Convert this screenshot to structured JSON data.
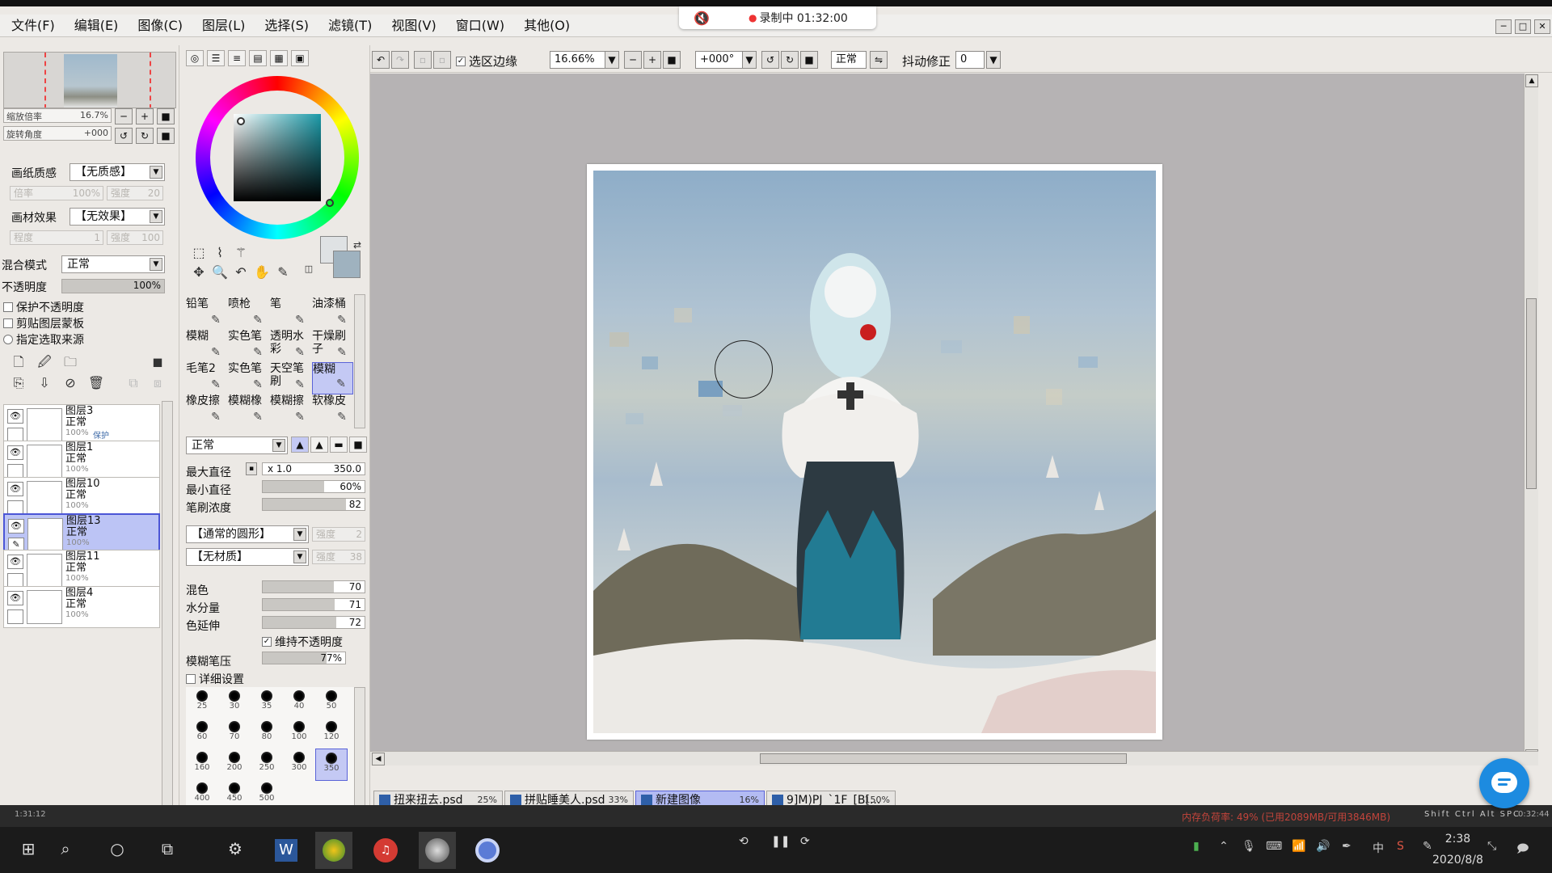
{
  "menu": [
    "文件(F)",
    "编辑(E)",
    "图像(C)",
    "图层(L)",
    "选择(S)",
    "滤镜(T)",
    "视图(V)",
    "窗口(W)",
    "其他(O)"
  ],
  "recording": {
    "label": "录制中 01:32:00",
    "mute_icon": "speaker-muted-icon"
  },
  "navigator": {
    "zoom_label": "缩放倍率",
    "zoom_value": "16.7%",
    "rotate_label": "旋转角度",
    "rotate_value": "+000"
  },
  "paper": {
    "texture_label": "画纸质感",
    "texture_value": "【无质感】",
    "strength_label": "倍率",
    "strength_value": "100%",
    "strength2_label": "强度",
    "strength2_value": "20",
    "effect_label": "画材效果",
    "effect_value": "【无效果】",
    "degree_label": "程度",
    "degree_value": "1",
    "degree2_label": "强度",
    "degree2_value": "100"
  },
  "blend": {
    "label": "混合模式",
    "value": "正常"
  },
  "opacity": {
    "label": "不透明度",
    "value": "100%",
    "fraction": 1.0
  },
  "checks": [
    "保护不透明度",
    "剪贴图层蒙板",
    "指定选取来源"
  ],
  "layers": [
    {
      "name": "图层3",
      "mode": "正常",
      "opacity": "100%",
      "protect": "保护",
      "selected": false
    },
    {
      "name": "图层1",
      "mode": "正常",
      "opacity": "100%",
      "protect": "",
      "selected": false
    },
    {
      "name": "图层10",
      "mode": "正常",
      "opacity": "100%",
      "protect": "",
      "selected": false
    },
    {
      "name": "图层13",
      "mode": "正常",
      "opacity": "100%",
      "protect": "",
      "selected": true
    },
    {
      "name": "图层11",
      "mode": "正常",
      "opacity": "100%",
      "protect": "",
      "selected": false
    },
    {
      "name": "图层4",
      "mode": "正常",
      "opacity": "100%",
      "protect": "",
      "selected": false
    }
  ],
  "brushes": [
    {
      "label": "铅笔",
      "icon": "pencil-icon"
    },
    {
      "label": "喷枪",
      "icon": "airbrush-icon"
    },
    {
      "label": "笔",
      "icon": "pen-icon"
    },
    {
      "label": "油漆桶",
      "icon": "bucket-icon"
    },
    {
      "label": "模糊",
      "icon": "blur-icon"
    },
    {
      "label": "实色笔",
      "icon": "brush-icon"
    },
    {
      "label": "透明水彩",
      "icon": "watercolor-icon"
    },
    {
      "label": "干燥刷子",
      "icon": "dry-brush-icon"
    },
    {
      "label": "毛笔2",
      "icon": "brush-icon"
    },
    {
      "label": "实色笔",
      "icon": "brush-icon"
    },
    {
      "label": "天空笔刷",
      "icon": "brush-icon"
    },
    {
      "label": "模糊",
      "icon": "blur-icon",
      "selected": true
    },
    {
      "label": "橡皮擦",
      "icon": "eraser-icon"
    },
    {
      "label": "模糊橡",
      "icon": "eraser-icon"
    },
    {
      "label": "模糊擦",
      "icon": "eraser-icon"
    },
    {
      "label": "软橡皮",
      "icon": "eraser-icon"
    }
  ],
  "brush_mode": "正常",
  "brush_props": {
    "max_diam_label": "最大直径",
    "max_diam_mult": "x 1.0",
    "max_diam_value": "350.0",
    "min_diam_label": "最小直径",
    "min_diam_value": "60%",
    "min_diam_fraction": 0.6,
    "density_label": "笔刷浓度",
    "density_value": "82",
    "density_fraction": 0.82,
    "shape_value": "【通常的圆形】",
    "shape_strength_label": "强度",
    "shape_strength_value": "2",
    "texture_value": "【无材质】",
    "texture_strength_label": "强度",
    "texture_strength_value": "38",
    "mix_label": "混色",
    "mix_value": "70",
    "mix_fraction": 0.7,
    "water_label": "水分量",
    "water_value": "71",
    "water_fraction": 0.71,
    "stretch_label": "色延伸",
    "stretch_value": "72",
    "stretch_fraction": 0.72,
    "keep_opacity_label": "维持不透明度",
    "blur_pressure_label": "模糊笔压",
    "blur_pressure_value": "77%",
    "blur_pressure_fraction": 0.77,
    "detail_label": "详细设置"
  },
  "brush_sizes": [
    "25",
    "30",
    "35",
    "40",
    "50",
    "60",
    "70",
    "80",
    "100",
    "120",
    "160",
    "200",
    "250",
    "300",
    "350",
    "400",
    "450",
    "500"
  ],
  "selected_size": "350",
  "toolbar": {
    "select_edge_label": "选区边缘",
    "zoom": "16.66%",
    "angle": "+000°",
    "mode": "正常",
    "stabilizer_label": "抖动修正",
    "stabilizer_value": "0"
  },
  "file_tabs": [
    {
      "name": "扭来扭去.psd",
      "pct": "25%",
      "active": false
    },
    {
      "name": "拼贴睡美人.psd",
      "pct": "33%",
      "active": false
    },
    {
      "name": "新建图像",
      "pct": "16%",
      "active": true
    },
    {
      "name": "9]M)PJ_`1F_[B[...",
      "pct": "150%",
      "active": false
    }
  ],
  "status": {
    "time_left": "1:31:12",
    "memory": "内存负荷率: 49% (已用2089MB/可用3846MB)",
    "keys": "Shift Ctrl Alt SPC",
    "time_right": "0:32:44"
  },
  "clock": {
    "time": "2:38",
    "date": "2020/8/8"
  },
  "colors": {
    "accent": "#4b55d6",
    "selection": "#bcc4f5",
    "canvas_bg": "#b6b3b4",
    "chat": "#1d8be0"
  }
}
